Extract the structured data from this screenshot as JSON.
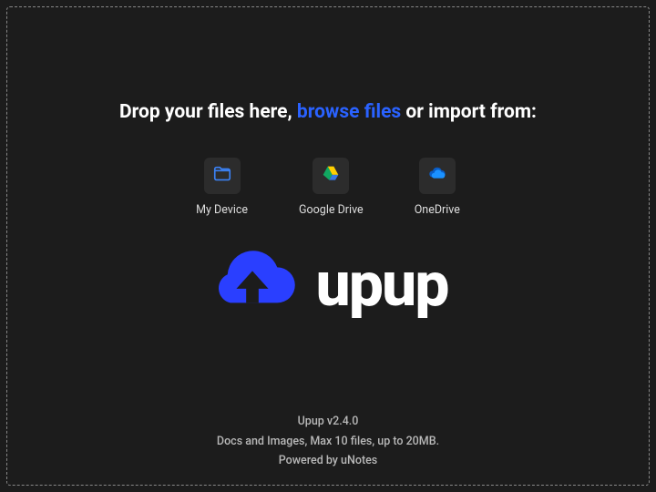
{
  "headline": {
    "prefix": "Drop your files here, ",
    "browse": "browse files",
    "suffix": " or import from:"
  },
  "sources": [
    {
      "id": "my-device",
      "label": "My Device",
      "icon": "folder-icon"
    },
    {
      "id": "google-drive",
      "label": "Google Drive",
      "icon": "google-drive-icon"
    },
    {
      "id": "onedrive",
      "label": "OneDrive",
      "icon": "onedrive-icon"
    }
  ],
  "logo": {
    "text": "upup",
    "accent_color": "#2a3fff"
  },
  "footer": {
    "version": "Upup v2.4.0",
    "limits": "Docs and Images, Max 10 files, up to 20MB.",
    "powered": "Powered by uNotes"
  }
}
